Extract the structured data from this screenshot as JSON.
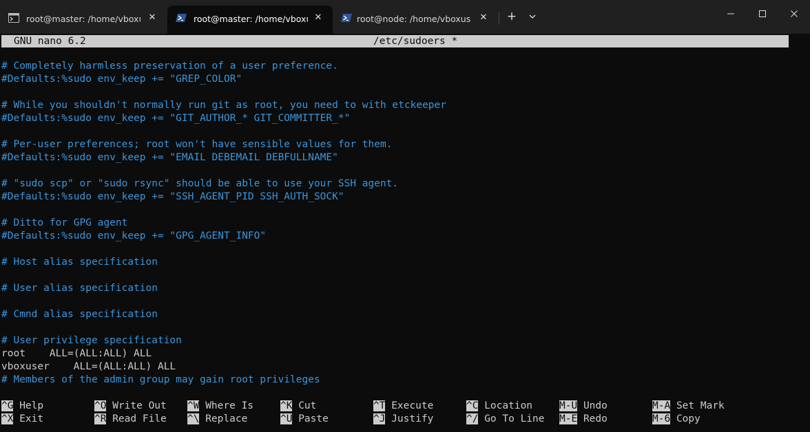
{
  "tabs": [
    {
      "title": "root@master: /home/vboxuser",
      "icon": "terminal-icon",
      "active": false
    },
    {
      "title": "root@master: /home/vboxuser",
      "icon": "powershell-icon",
      "active": true
    },
    {
      "title": "root@node: /home/vboxuser",
      "icon": "powershell-icon",
      "active": false
    }
  ],
  "tab_close_glyph": "✕",
  "new_tab_glyph": "+",
  "colors": {
    "comment": "#3a96dd",
    "plain": "#cccccc",
    "background": "#0c0c0c",
    "titlebar": "#202020"
  },
  "nano": {
    "version": "GNU nano 6.2",
    "filename": "/etc/sudoers *"
  },
  "lines": [
    {
      "text": "# Completely harmless preservation of a user preference.",
      "type": "comment"
    },
    {
      "text": "#Defaults:%sudo env_keep += \"GREP_COLOR\"",
      "type": "comment"
    },
    {
      "text": "",
      "type": "blank"
    },
    {
      "text": "# While you shouldn't normally run git as root, you need to with etckeeper",
      "type": "comment"
    },
    {
      "text": "#Defaults:%sudo env_keep += \"GIT_AUTHOR_* GIT_COMMITTER_*\"",
      "type": "comment"
    },
    {
      "text": "",
      "type": "blank"
    },
    {
      "text": "# Per-user preferences; root won't have sensible values for them.",
      "type": "comment"
    },
    {
      "text": "#Defaults:%sudo env_keep += \"EMAIL DEBEMAIL DEBFULLNAME\"",
      "type": "comment"
    },
    {
      "text": "",
      "type": "blank"
    },
    {
      "text": "# \"sudo scp\" or \"sudo rsync\" should be able to use your SSH agent.",
      "type": "comment"
    },
    {
      "text": "#Defaults:%sudo env_keep += \"SSH_AGENT_PID SSH_AUTH_SOCK\"",
      "type": "comment"
    },
    {
      "text": "",
      "type": "blank"
    },
    {
      "text": "# Ditto for GPG agent",
      "type": "comment"
    },
    {
      "text": "#Defaults:%sudo env_keep += \"GPG_AGENT_INFO\"",
      "type": "comment"
    },
    {
      "text": "",
      "type": "blank"
    },
    {
      "text": "# Host alias specification",
      "type": "comment"
    },
    {
      "text": "",
      "type": "blank"
    },
    {
      "text": "# User alias specification",
      "type": "comment"
    },
    {
      "text": "",
      "type": "blank"
    },
    {
      "text": "# Cmnd alias specification",
      "type": "comment"
    },
    {
      "text": "",
      "type": "blank"
    },
    {
      "text": "# User privilege specification",
      "type": "comment"
    },
    {
      "text": "root    ALL=(ALL:ALL) ALL",
      "type": "plain"
    },
    {
      "text": "vboxuser    ALL=(ALL:ALL) ALL",
      "type": "plain"
    },
    {
      "text": "# Members of the admin group may gain root privileges",
      "type": "comment"
    }
  ],
  "shortcuts": [
    [
      {
        "key": "^G",
        "label": "Help"
      },
      {
        "key": "^O",
        "label": "Write Out"
      },
      {
        "key": "^W",
        "label": "Where Is"
      },
      {
        "key": "^K",
        "label": "Cut"
      },
      {
        "key": "^T",
        "label": "Execute"
      },
      {
        "key": "^C",
        "label": "Location"
      },
      {
        "key": "M-U",
        "label": "Undo"
      },
      {
        "key": "M-A",
        "label": "Set Mark"
      }
    ],
    [
      {
        "key": "^X",
        "label": "Exit"
      },
      {
        "key": "^R",
        "label": "Read File"
      },
      {
        "key": "^\\",
        "label": "Replace"
      },
      {
        "key": "^U",
        "label": "Paste"
      },
      {
        "key": "^J",
        "label": "Justify"
      },
      {
        "key": "^/",
        "label": "Go To Line"
      },
      {
        "key": "M-E",
        "label": "Redo"
      },
      {
        "key": "M-6",
        "label": "Copy"
      }
    ]
  ]
}
